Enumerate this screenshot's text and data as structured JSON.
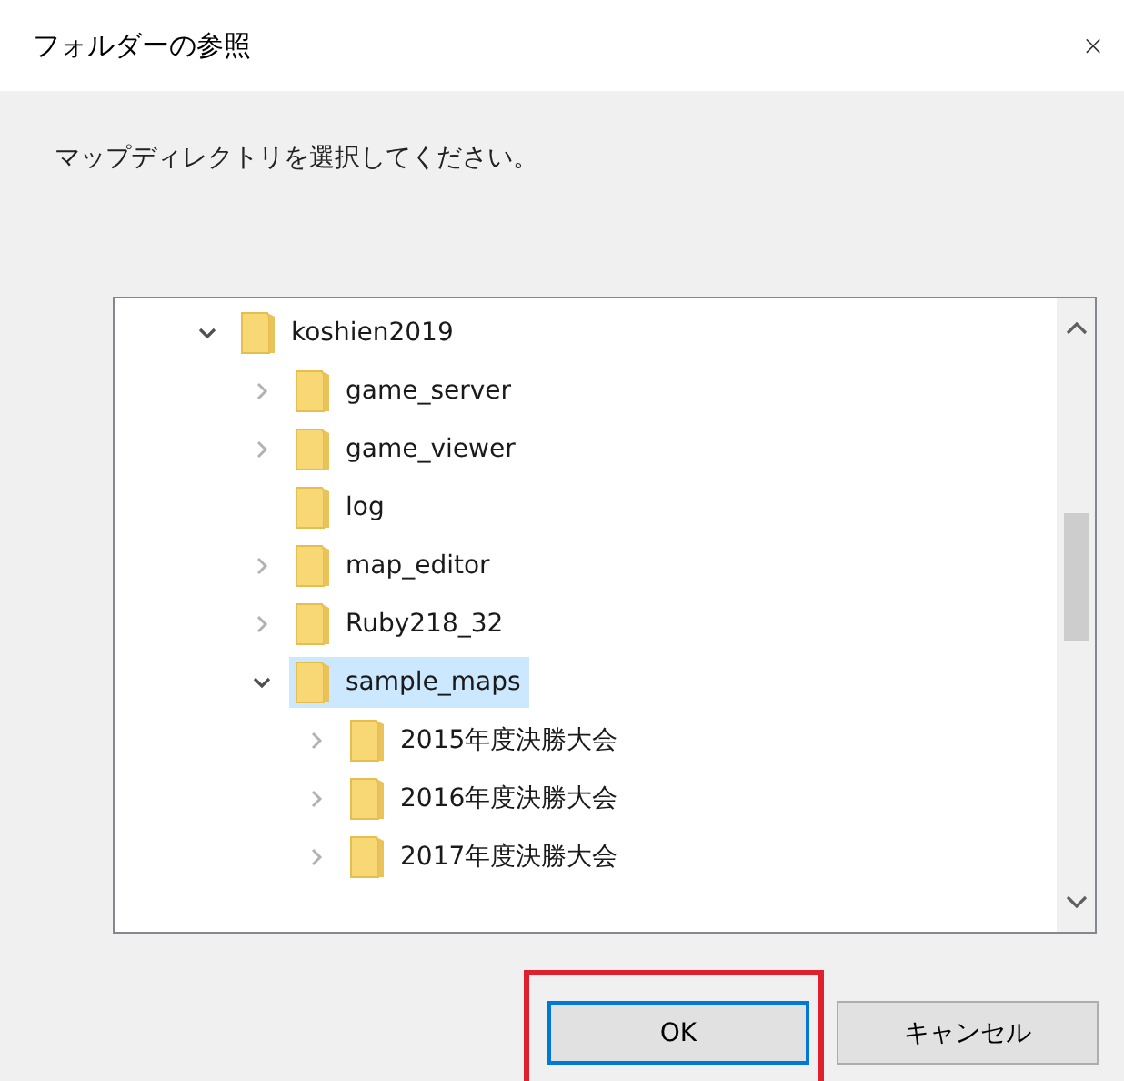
{
  "window": {
    "title": "フォルダーの参照",
    "close": "×"
  },
  "prompt": "マップディレクトリを選択してください。",
  "tree": [
    {
      "label": "koshien2019",
      "expanded": true,
      "has_children": true,
      "selected": false,
      "children": [
        {
          "label": "game_server",
          "expanded": false,
          "has_children": true,
          "selected": false
        },
        {
          "label": "game_viewer",
          "expanded": false,
          "has_children": true,
          "selected": false
        },
        {
          "label": "log",
          "selected": false
        },
        {
          "label": "map_editor",
          "expanded": false,
          "has_children": true,
          "selected": false
        },
        {
          "label": "Ruby218_32",
          "expanded": false,
          "has_children": true,
          "selected": false
        },
        {
          "label": "sample_maps",
          "expanded": true,
          "has_children": true,
          "selected": true,
          "children": [
            {
              "label": "2015年度決勝大会",
              "expanded": false,
              "has_children": true,
              "selected": false
            },
            {
              "label": "2016年度決勝大会",
              "expanded": false,
              "has_children": true,
              "selected": false
            },
            {
              "label": "2017年度決勝大会",
              "expanded": false,
              "has_children": true,
              "selected": false
            }
          ]
        }
      ]
    }
  ],
  "buttons": [
    {
      "label": "OK",
      "focused": true,
      "highlighted": true
    },
    {
      "label": "キャンセル",
      "focused": false,
      "highlighted": false
    }
  ]
}
